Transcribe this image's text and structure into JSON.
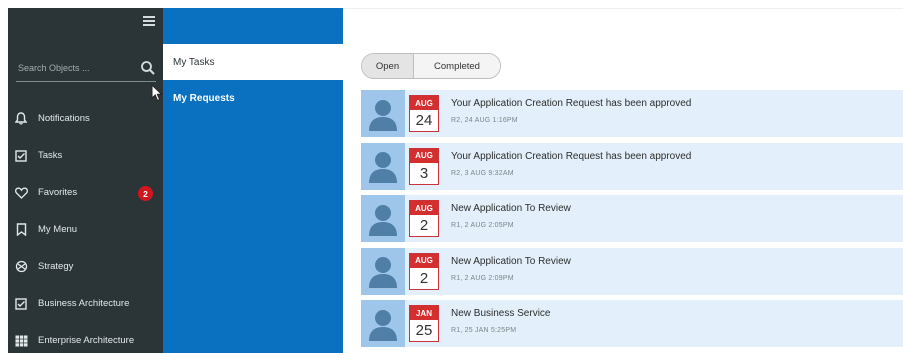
{
  "sidebar": {
    "search_placeholder": "Search Objects ...",
    "items": [
      {
        "label": "Notifications",
        "icon": "bell-icon"
      },
      {
        "label": "Tasks",
        "icon": "checkbox-icon"
      },
      {
        "label": "Favorites",
        "icon": "heart-icon",
        "badge": "2"
      },
      {
        "label": "My Menu",
        "icon": "bookmark-icon"
      },
      {
        "label": "Strategy",
        "icon": "strategy-icon"
      },
      {
        "label": "Business Architecture",
        "icon": "checkbox-icon"
      },
      {
        "label": "Enterprise Architecture",
        "icon": "grid-icon"
      }
    ]
  },
  "subnav": {
    "items": [
      {
        "label": "My Tasks"
      },
      {
        "label": "My Requests"
      }
    ]
  },
  "toggle": {
    "open_label": "Open",
    "completed_label": "Completed"
  },
  "tasks": [
    {
      "month": "AUG",
      "day": "24",
      "title": "Your Application Creation Request has been approved",
      "meta": "R2, 24 AUG 1:16PM"
    },
    {
      "month": "AUG",
      "day": "3",
      "title": "Your Application Creation Request has been approved",
      "meta": "R2, 3 AUG 9:32AM"
    },
    {
      "month": "AUG",
      "day": "2",
      "title": "New Application To Review",
      "meta": "R1, 2 AUG 2:05PM"
    },
    {
      "month": "AUG",
      "day": "2",
      "title": "New Application To Review",
      "meta": "R1, 2 AUG 2:09PM"
    },
    {
      "month": "JAN",
      "day": "25",
      "title": "New Business Service",
      "meta": "R1, 25 JAN 5:25PM"
    }
  ],
  "colors": {
    "sidebar_bg": "#2b3538",
    "subnav_bg": "#0a71c1",
    "task_bg": "#e3f0fb",
    "avatar_bg": "#9dc6ea",
    "date_red": "#d32f2f",
    "badge_red": "#d0171d"
  }
}
